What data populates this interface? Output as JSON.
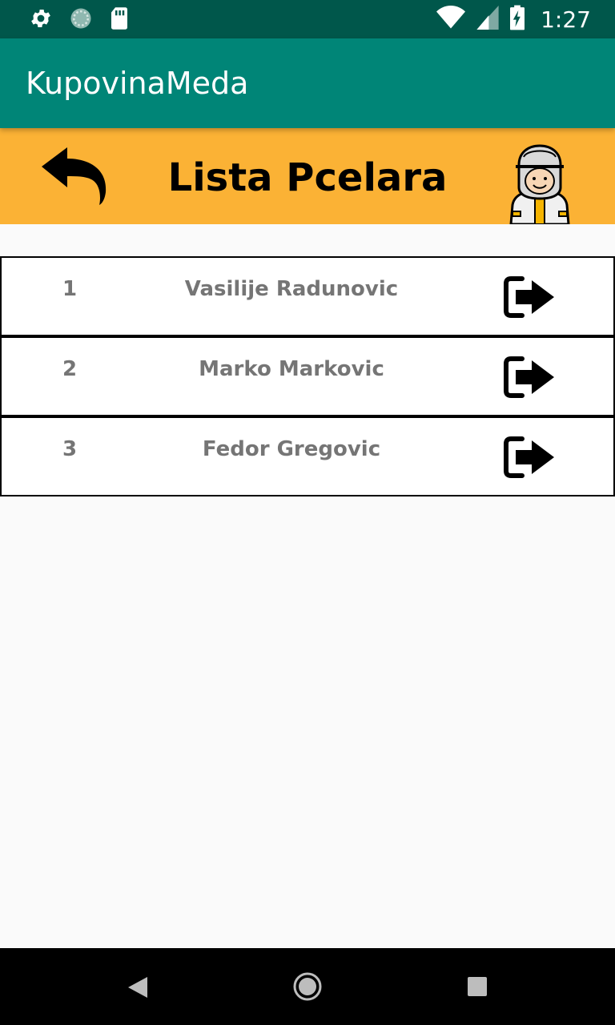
{
  "status_bar": {
    "time": "1:27",
    "left_icons": [
      "settings-icon",
      "sync-icon",
      "sd-card-icon"
    ],
    "right_icons": [
      "wifi-icon",
      "cell-signal-icon",
      "battery-charging-icon"
    ]
  },
  "app_bar": {
    "title": "KupovinaMeda"
  },
  "header": {
    "title": "Lista Pcelara",
    "back_icon": "back-arrow-icon",
    "avatar_icon": "beekeeper-icon",
    "background": "#fbb235"
  },
  "beekeepers": [
    {
      "number": "1",
      "name": "Vasilije Radunovic",
      "action_icon": "sign-in-icon"
    },
    {
      "number": "2",
      "name": "Marko Markovic",
      "action_icon": "sign-in-icon"
    },
    {
      "number": "3",
      "name": "Fedor Gregovic",
      "action_icon": "sign-in-icon"
    }
  ],
  "nav_bar": {
    "buttons": [
      "nav-back-icon",
      "nav-home-icon",
      "nav-recents-icon"
    ]
  },
  "colors": {
    "status_bar": "#00574b",
    "app_bar": "#008577",
    "header_band": "#fbb235",
    "row_text": "#757575"
  }
}
